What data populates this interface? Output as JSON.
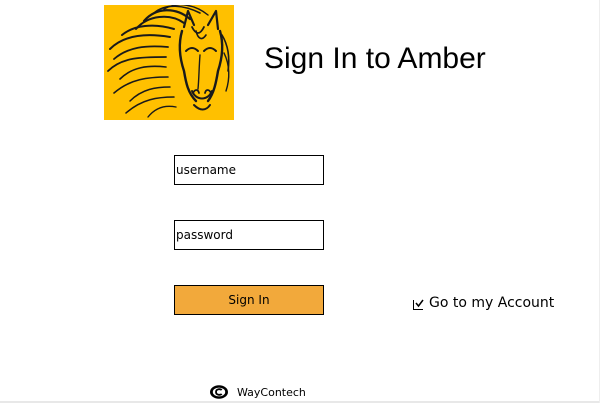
{
  "header": {
    "title": "Sign In to Amber",
    "logo_icon": "horse-head-logo-icon"
  },
  "form": {
    "username": {
      "value": "",
      "placeholder": "username"
    },
    "password": {
      "value": "",
      "placeholder": "password"
    },
    "signin_label": "Sign In"
  },
  "account_option": {
    "label": "Go to my Account",
    "checked": true
  },
  "footer": {
    "icon": "copyright-icon",
    "text": "WayContech"
  },
  "colors": {
    "logo_background": "#ffc000",
    "signin_button": "#f2a93b",
    "text": "#000000",
    "background": "#ffffff"
  }
}
